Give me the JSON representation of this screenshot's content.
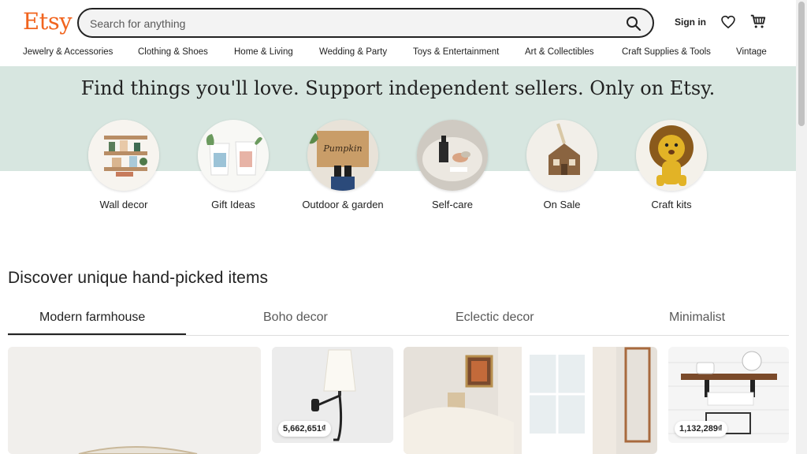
{
  "header": {
    "logo": "Etsy",
    "search_placeholder": "Search for anything",
    "signin": "Sign in"
  },
  "categories": [
    "Jewelry & Accessories",
    "Clothing & Shoes",
    "Home & Living",
    "Wedding & Party",
    "Toys & Entertainment",
    "Art & Collectibles",
    "Craft Supplies & Tools",
    "Vintage"
  ],
  "hero": {
    "title": "Find things you'll love. Support independent sellers. Only on Etsy.",
    "items": [
      {
        "label": "Wall decor"
      },
      {
        "label": "Gift Ideas"
      },
      {
        "label": "Outdoor & garden"
      },
      {
        "label": "Self-care"
      },
      {
        "label": "On Sale"
      },
      {
        "label": "Craft kits"
      }
    ]
  },
  "discover": {
    "title": "Discover unique hand-picked items",
    "tabs": [
      "Modern farmhouse",
      "Boho decor",
      "Eclectic decor",
      "Minimalist"
    ],
    "active_tab": "Modern farmhouse"
  },
  "products": [
    {
      "price": ""
    },
    {
      "price": "5,662,651₫"
    },
    {
      "price": ""
    },
    {
      "price": "1,132,289₫"
    }
  ],
  "colors": {
    "brand": "#f1641e",
    "hero_bg": "#d7e6e0"
  }
}
